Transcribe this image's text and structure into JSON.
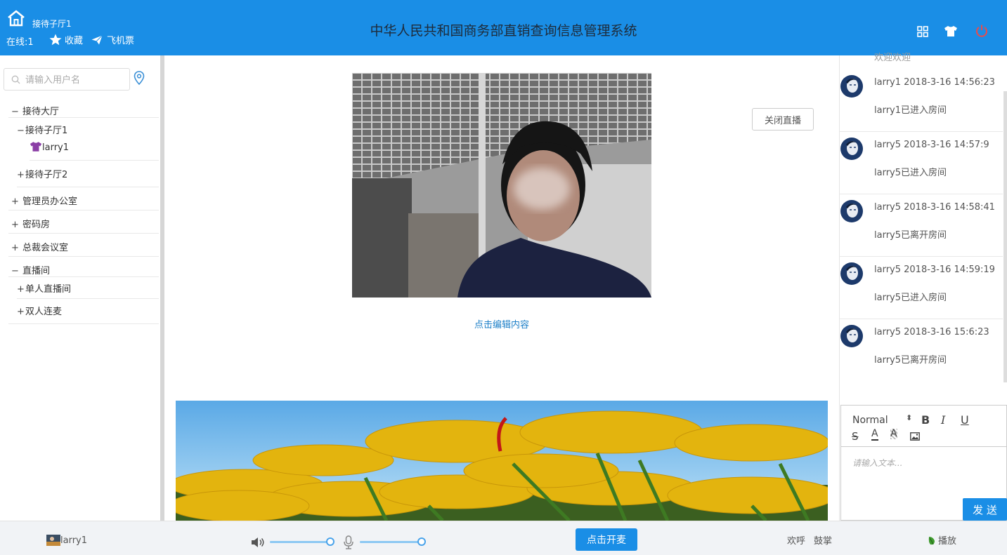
{
  "header": {
    "room_name": "接待子厅1",
    "online_text": "在线:1",
    "favorites_label": "收藏",
    "ticket_label": "飞机票",
    "title": "中华人民共和国商务部直销查询信息管理系统",
    "icons": [
      "home-icon",
      "star-icon",
      "paper-plane-icon",
      "grid-icon",
      "shirt-icon",
      "power-icon"
    ],
    "power_color": "#e94b4b"
  },
  "sidebar": {
    "search_placeholder": "请输入用户名",
    "tree": [
      {
        "symbol": "−",
        "label": "接待大厅"
      },
      {
        "symbol": "−",
        "label": "接待子厅1"
      },
      {
        "symbol": "",
        "label": "larry1"
      },
      {
        "symbol": "+",
        "label": "接待子厅2"
      },
      {
        "symbol": "+",
        "label": "管理员办公室"
      },
      {
        "symbol": "+",
        "label": "密码房"
      },
      {
        "symbol": "+",
        "label": "总裁会议室"
      },
      {
        "symbol": "−",
        "label": "直播间"
      },
      {
        "symbol": "+",
        "label": "单人直播间"
      },
      {
        "symbol": "+",
        "label": "双人连麦"
      }
    ]
  },
  "main": {
    "close_live_label": "关闭直播",
    "edit_link": "点击编辑内容"
  },
  "chat": {
    "partial_top": "欢迎欢迎",
    "messages": [
      {
        "head": "larry1 2018-3-16 14:56:23",
        "body": "larry1已进入房间"
      },
      {
        "head": "larry5 2018-3-16 14:57:9",
        "body": "larry5已进入房间"
      },
      {
        "head": "larry5 2018-3-16 14:58:41",
        "body": "larry5已离开房间"
      },
      {
        "head": "larry5 2018-3-16 14:59:19",
        "body": "larry5已进入房间"
      },
      {
        "head": "larry5 2018-3-16 15:6:23",
        "body": "larry5已离开房间"
      }
    ],
    "editor": {
      "format_select": "Normal",
      "placeholder": "请输入文本...",
      "send_label": "发 送"
    }
  },
  "footer": {
    "user": "larry1",
    "volume_level": 1.0,
    "mic_level": 1.0,
    "mic_button": "点击开麦",
    "cheer_label": "欢呼",
    "clap_label": "鼓掌",
    "play_label": "播放"
  },
  "colors": {
    "accent": "#1a8ee6"
  }
}
